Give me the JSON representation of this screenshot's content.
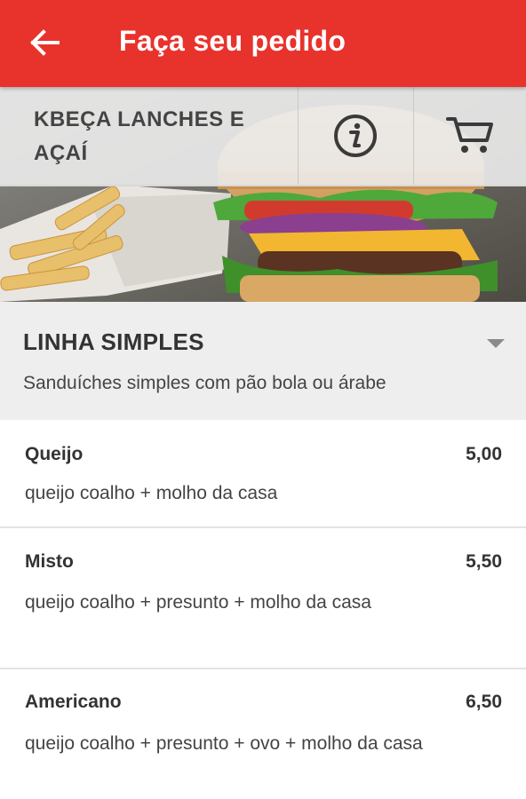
{
  "appbar": {
    "title": "Faça seu pedido",
    "color": "#e8332c",
    "back_icon": "arrow-left-icon"
  },
  "store": {
    "name": "KBEÇA LANCHES E AÇAÍ",
    "info_icon": "info-icon",
    "cart_icon": "cart-icon",
    "banner": "burger-and-fries-photo"
  },
  "category": {
    "title": "LINHA SIMPLES",
    "description": "Sanduíches simples com pão bola ou árabe",
    "dropdown_icon": "dropdown-arrow-icon"
  },
  "items": [
    {
      "name": "Queijo",
      "price": "5,00",
      "description": "queijo coalho + molho da casa"
    },
    {
      "name": "Misto",
      "price": "5,50",
      "description": "queijo coalho + presunto + molho da casa"
    },
    {
      "name": "Americano",
      "price": "6,50",
      "description": "queijo coalho + presunto + ovo + molho da casa"
    }
  ]
}
